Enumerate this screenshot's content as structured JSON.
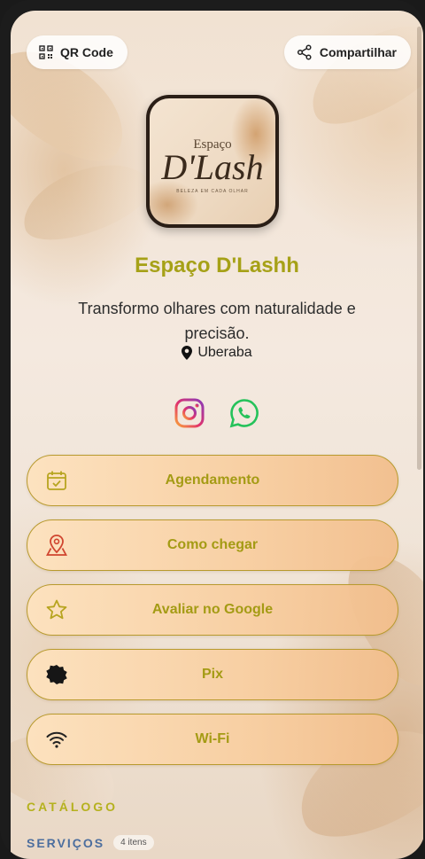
{
  "header": {
    "qr_label": "QR Code",
    "share_label": "Compartilhar"
  },
  "logo": {
    "top_text": "Espaço",
    "main_text": "D'Lash",
    "tagline": "BELEZA EM CADA OLHAR"
  },
  "profile": {
    "name": "Espaço D'Lashh",
    "bio": "Transformo olhares com naturalidade e precisão.",
    "location": "Uberaba"
  },
  "socials": [
    {
      "name": "instagram-icon"
    },
    {
      "name": "whatsapp-icon"
    }
  ],
  "links": [
    {
      "label": "Agendamento",
      "icon": "calendar-check-icon"
    },
    {
      "label": "Como chegar",
      "icon": "map-pin-icon"
    },
    {
      "label": "Avaliar no Google",
      "icon": "star-icon"
    },
    {
      "label": "Pix",
      "icon": "pix-icon"
    },
    {
      "label": "Wi-Fi",
      "icon": "wifi-icon"
    }
  ],
  "catalog": {
    "title": "CATÁLOGO",
    "services_label": "SERVIÇOS",
    "services_count": "4 itens"
  },
  "colors": {
    "accent": "#a6a117",
    "button_border": "#b89a2e",
    "services_label": "#4c6e9e"
  }
}
